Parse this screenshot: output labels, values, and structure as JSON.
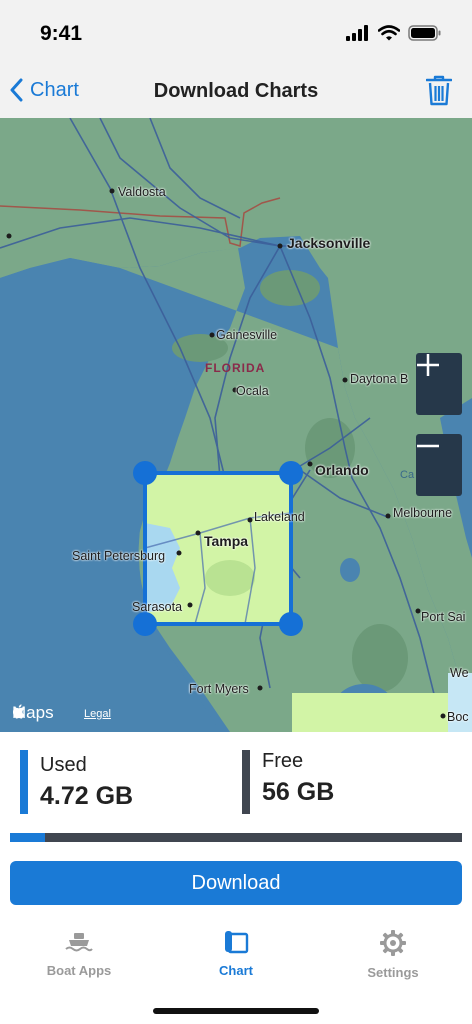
{
  "status": {
    "time": "9:41"
  },
  "nav": {
    "back_label": "Chart",
    "title": "Download Charts"
  },
  "map": {
    "labels": {
      "valdosta": "Valdosta",
      "jacksonville": "Jacksonville",
      "gainesville": "Gainesville",
      "florida": "FLORIDA",
      "ocala": "Ocala",
      "daytona": "Daytona B",
      "orlando": "Orlando",
      "lakeland": "Lakeland",
      "melbourne": "Melbourne",
      "tampa": "Tampa",
      "stpete": "Saint Petersburg",
      "sarasota": "Sarasota",
      "portsaint": "Port Sai",
      "fortmyers": "Fort Myers",
      "we": "We",
      "boc": "Boc",
      "ca": "Ca"
    },
    "attribution": "Maps",
    "legal": "Legal"
  },
  "storage": {
    "used_label": "Used",
    "used_value": "4.72 GB",
    "free_label": "Free",
    "free_value": "56 GB",
    "used_fraction": 0.077
  },
  "download_label": "Download",
  "tabs": {
    "boat_apps": "Boat Apps",
    "chart": "Chart",
    "settings": "Settings"
  },
  "colors": {
    "accent": "#1a7ad6",
    "storage_free_bar": "#404650",
    "selection": "#1570d6"
  },
  "icons": [
    "back-chevron-icon",
    "trash-icon",
    "plus-icon",
    "minus-icon",
    "apple-logo-icon",
    "ship-icon",
    "chart-book-icon",
    "gear-icon"
  ]
}
